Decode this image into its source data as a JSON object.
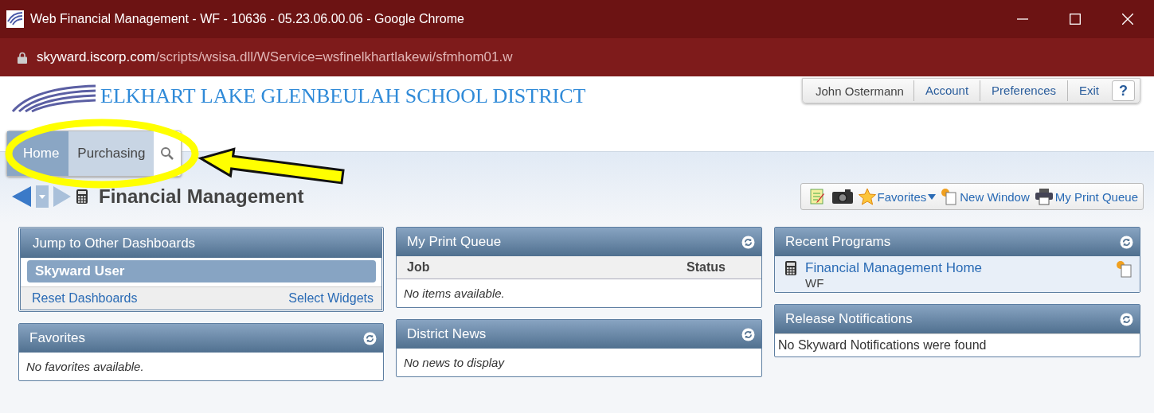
{
  "window": {
    "title": "Web Financial Management - WF - 10636 - 05.23.06.00.06 - Google Chrome"
  },
  "address_bar": {
    "domain": "skyward.iscorp.com",
    "path": "/scripts/wsisa.dll/WService=wsfinelkhartlakewi/sfmhom01.w"
  },
  "header": {
    "district": "ELKHART LAKE GLENBEULAH SCHOOL DISTRICT",
    "user": "John Ostermann",
    "links": [
      "Account",
      "Preferences",
      "Exit"
    ],
    "help": "?"
  },
  "nav_tabs": [
    {
      "label": "Home",
      "selected": true
    },
    {
      "label": "Purchasing",
      "selected": false
    }
  ],
  "page_title": "Financial Management",
  "toolbar": {
    "links": [
      "Favorites",
      "New Window",
      "My Print Queue"
    ]
  },
  "columns": [
    [
      {
        "kind": "dashboards",
        "title": "Jump to Other Dashboards",
        "items": [
          {
            "label": "Skyward User",
            "selected": true
          }
        ],
        "links": [
          "Reset Dashboards",
          "Select Widgets"
        ]
      },
      {
        "kind": "message",
        "title": "Favorites",
        "message": "No favorites available."
      }
    ],
    [
      {
        "kind": "table",
        "title": "My Print Queue",
        "columns": [
          "Job",
          "Status"
        ],
        "message": "No items available."
      },
      {
        "kind": "message",
        "title": "District News",
        "message": "No news to display"
      }
    ],
    [
      {
        "kind": "programs",
        "title": "Recent Programs",
        "programs": [
          {
            "name": "Financial Management Home",
            "code": "WF"
          }
        ]
      },
      {
        "kind": "notice",
        "title": "Release Notifications",
        "message": "No Skyward Notifications were found"
      }
    ]
  ]
}
